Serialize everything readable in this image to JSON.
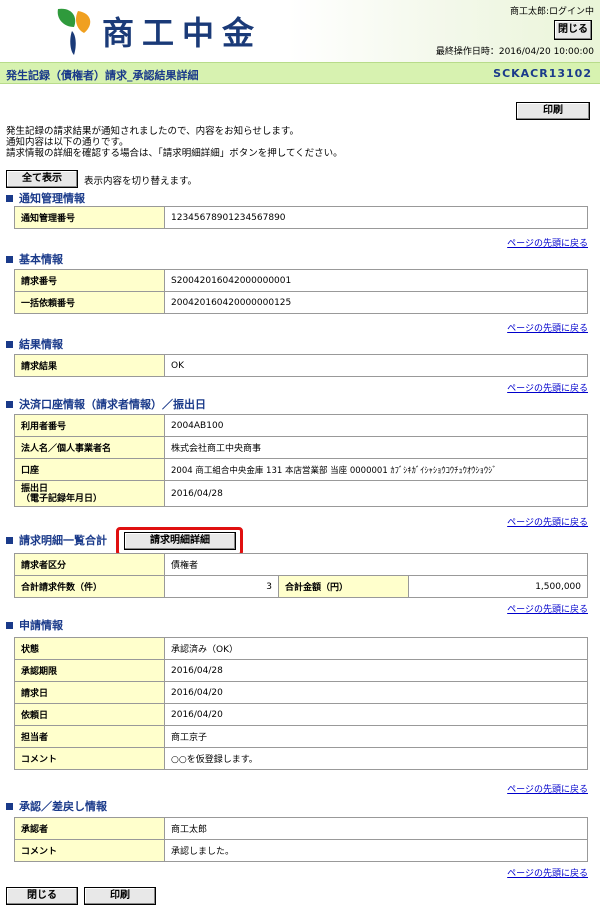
{
  "header": {
    "logo_text": "商工中金",
    "user_status": "商工太郎:ログイン中",
    "close_label": "閉じる",
    "last_operation": "最終操作日時：2016/04/20 10:00:00"
  },
  "titlebar": {
    "title": "発生記録（債権者）請求_承認結果詳細",
    "screen_code": "SCKACR13102"
  },
  "print_label": "印刷",
  "message": {
    "line1": "発生記録の請求結果が通知されましたので、内容をお知らせします。",
    "line2": "通知内容は以下の通りです。",
    "line3": "請求情報の詳細を確認する場合は、「請求明細詳細」ボタンを押してください。"
  },
  "show_all": {
    "label": "全て表示",
    "text": "表示内容を切り替えます。"
  },
  "top_link": "ページの先頭に戻る",
  "sections": {
    "notice": {
      "title": "通知管理情報",
      "rows": [
        {
          "key": "通知管理番号",
          "value": "12345678901234567890"
        }
      ]
    },
    "basic": {
      "title": "基本情報",
      "rows": [
        {
          "key": "請求番号",
          "value": "S20042016042000000001"
        },
        {
          "key": "一括依頼番号",
          "value": "200420160420000000125"
        }
      ]
    },
    "result": {
      "title": "結果情報",
      "rows": [
        {
          "key": "請求結果",
          "value": "OK"
        }
      ]
    },
    "settlement": {
      "title": "決済口座情報（請求者情報）／振出日",
      "rows": [
        {
          "key": "利用者番号",
          "value": "2004AB100"
        },
        {
          "key": "法人名／個人事業者名",
          "value": "株式会社商工中央商事"
        },
        {
          "key": "口座",
          "value": "2004 商工組合中央金庫 131 本店営業部 当座 0000001 ｶﾌﾞｼｷｶﾞｲｼｬｼｮｳｺｳﾁｭｳｵｳｼｮｳｼﾞ"
        },
        {
          "key": "振出日",
          "key2": "（電子記録年月日）",
          "value": "2016/04/28"
        }
      ]
    },
    "summary": {
      "title": "請求明細一覧合計",
      "detail_button": "請求明細詳細",
      "requester_key": "請求者区分",
      "requester_value": "債権者",
      "count_key": "合計請求件数（件）",
      "count_value": "3",
      "amount_key": "合計金額（円）",
      "amount_value": "1,500,000"
    },
    "application": {
      "title": "申請情報",
      "rows": [
        {
          "key": "状態",
          "value": "承認済み（OK）"
        },
        {
          "key": "承認期限",
          "value": "2016/04/28"
        },
        {
          "key": "請求日",
          "value": "2016/04/20"
        },
        {
          "key": "依頼日",
          "value": "2016/04/20"
        },
        {
          "key": "担当者",
          "value": "商工京子"
        },
        {
          "key": "コメント",
          "value": "○○を仮登録します。"
        }
      ]
    },
    "approval": {
      "title": "承認／差戻し情報",
      "rows": [
        {
          "key": "承認者",
          "value": "商工太郎"
        },
        {
          "key": "コメント",
          "value": "承認しました。"
        }
      ]
    }
  },
  "footer": {
    "close_label": "閉じる",
    "print_label": "印刷"
  },
  "colors": {
    "accent": "#1a3a8a",
    "titlebar_bg": "#d7f2b0",
    "key_bg": "#ffffcc",
    "highlight": "#e01010"
  }
}
